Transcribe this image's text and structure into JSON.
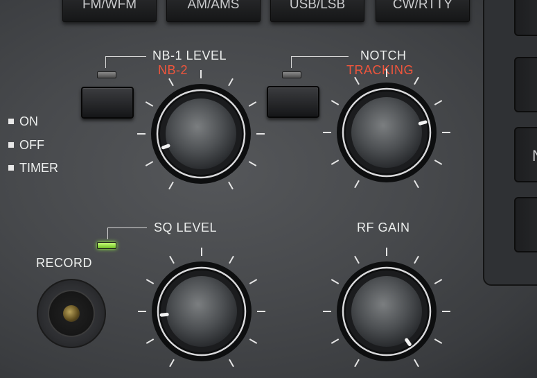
{
  "top_buttons": [
    "FM/WFM",
    "AM/AMS",
    "USB/LSB",
    "CW/RTTY"
  ],
  "side_buttons": [
    "",
    "",
    "N",
    ""
  ],
  "nb": {
    "label": "NB-1 LEVEL",
    "sublabel": "NB-2"
  },
  "notch": {
    "label": "NOTCH",
    "sublabel": "TRACKING"
  },
  "sq": {
    "label": "SQ LEVEL"
  },
  "rf": {
    "label": "RF GAIN"
  },
  "power_options": [
    "ON",
    "OFF",
    "TIMER"
  ],
  "record": {
    "label": "RECORD"
  },
  "colors": {
    "label": "#eceeed",
    "sublabel": "#f0553c",
    "led_active": "#9aff45"
  }
}
